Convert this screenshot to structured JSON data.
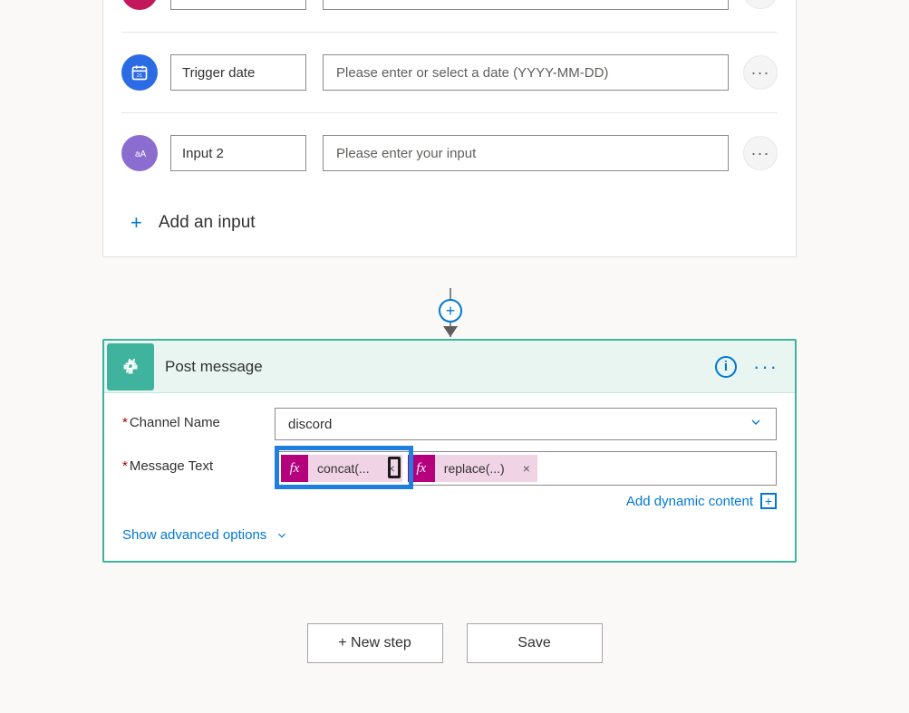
{
  "trigger": {
    "rows": [
      {
        "name": "",
        "placeholder": ""
      },
      {
        "name": "Trigger date",
        "placeholder": "Please enter or select a date (YYYY-MM-DD)"
      },
      {
        "name": "Input 2",
        "placeholder": "Please enter your input"
      }
    ],
    "add_input_label": "Add an input"
  },
  "action": {
    "title": "Post message",
    "fields": {
      "channel_label": "Channel Name",
      "channel_value": "discord",
      "message_label": "Message Text"
    },
    "tokens": [
      {
        "label": "concat(..."
      },
      {
        "label": "replace(...)"
      }
    ],
    "dynamic_content_label": "Add dynamic content",
    "show_advanced_label": "Show advanced options"
  },
  "footer": {
    "new_step": "+ New step",
    "save": "Save"
  }
}
